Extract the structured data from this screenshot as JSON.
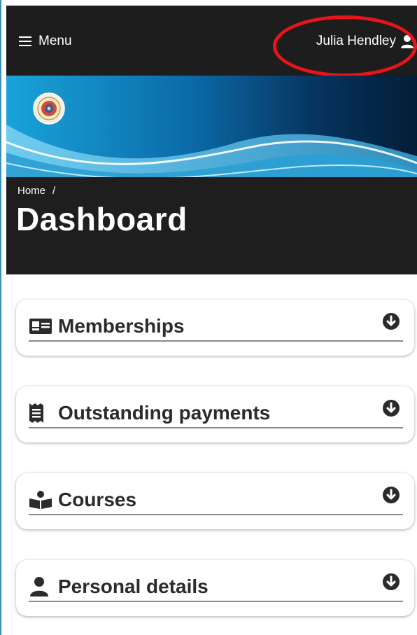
{
  "header": {
    "menu_label": "Menu",
    "user_name": "Julia Hendley"
  },
  "hero": {
    "breadcrumb_home": "Home",
    "breadcrumb_separator": "/",
    "page_title": "Dashboard"
  },
  "sections": [
    {
      "label": "Memberships",
      "icon": "id-card-icon"
    },
    {
      "label": "Outstanding payments",
      "icon": "receipt-icon"
    },
    {
      "label": "Courses",
      "icon": "book-reader-icon"
    },
    {
      "label": "Personal details",
      "icon": "user-icon"
    }
  ],
  "colors": {
    "nav_bg": "#1d1d1d",
    "accent_blue": "#1f8fc9",
    "highlight": "#e8141c"
  }
}
